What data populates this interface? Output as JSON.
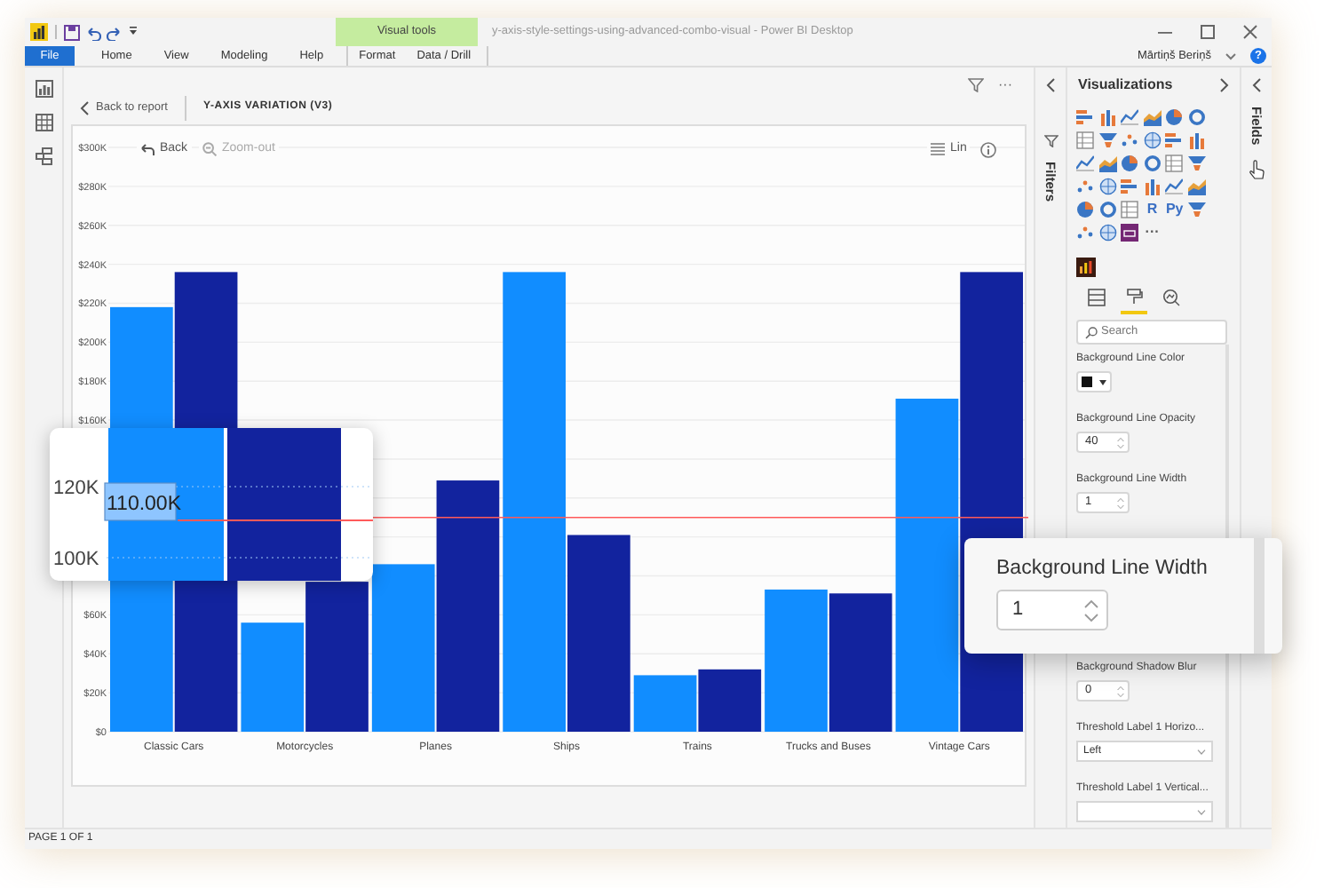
{
  "title_bar": {
    "title": "y-axis-style-settings-using-advanced-combo-visual - Power BI Desktop",
    "context_tab": "Visual tools"
  },
  "ribbon_tabs": [
    {
      "label": "File",
      "kind": "file"
    },
    {
      "label": "Home",
      "kind": "main"
    },
    {
      "label": "View",
      "kind": "main"
    },
    {
      "label": "Modeling",
      "kind": "main"
    },
    {
      "label": "Help",
      "kind": "main"
    },
    {
      "label": "Format",
      "kind": "context"
    },
    {
      "label": "Data / Drill",
      "kind": "context"
    }
  ],
  "user": {
    "name": "Mārtiņš Beriņš",
    "help": "?"
  },
  "visual_header": {
    "back_link": "Back to report",
    "title": "Y-AXIS VARIATION (V3)",
    "more": "···"
  },
  "toolbar": {
    "back": "Back",
    "zoom_out": {
      "label": "Zoom-out",
      "disabled": true
    },
    "scale": "Lin"
  },
  "chart": {
    "chart_data": {
      "type": "bar",
      "categories": [
        "Classic Cars",
        "Motorcycles",
        "Planes",
        "Ships",
        "Trains",
        "Trucks and Buses",
        "Vintage Cars"
      ],
      "series": [
        {
          "color": "#118dff",
          "values": [
            218000,
            56000,
            86000,
            236000,
            29000,
            73000,
            171000
          ]
        },
        {
          "color": "#12239e",
          "values": [
            236000,
            77000,
            129000,
            101000,
            32000,
            71000,
            236000
          ]
        }
      ],
      "grid": true,
      "ylim": [
        0,
        300000
      ],
      "yticks": [
        {
          "value": 0,
          "label": "$0"
        },
        {
          "value": 20000,
          "label": "$20K"
        },
        {
          "value": 40000,
          "label": "$40K"
        },
        {
          "value": 60000,
          "label": "$60K"
        },
        {
          "value": 160000,
          "label": "$160K"
        },
        {
          "value": 180000,
          "label": "$180K"
        },
        {
          "value": 200000,
          "label": "$200K"
        },
        {
          "value": 220000,
          "label": "$220K"
        },
        {
          "value": 240000,
          "label": "$240K"
        },
        {
          "value": 260000,
          "label": "$260K"
        },
        {
          "value": 280000,
          "label": "$280K"
        },
        {
          "value": 300000,
          "label": "$300K"
        }
      ],
      "ref_lines": [
        {
          "axis": "y",
          "value": 110000,
          "color": "#ff5a5a"
        }
      ]
    }
  },
  "zoom_popup": {
    "ticks": [
      "120K",
      "100K"
    ],
    "value": "110.00K"
  },
  "filters_pane": {
    "label": "Filters"
  },
  "visualizations": {
    "title": "Visualizations",
    "glyphs": [
      "R",
      "Py"
    ],
    "more": "···"
  },
  "format_tabs": [
    {
      "selected": false
    },
    {
      "selected": true
    },
    {
      "selected": false
    }
  ],
  "search": {
    "placeholder": "Search"
  },
  "settings": [
    {
      "kind": "color",
      "label": "Background Line Color",
      "color": "#111111"
    },
    {
      "kind": "spinner",
      "label": "Background Line Opacity",
      "value": "40"
    },
    {
      "kind": "spinner",
      "label": "Background Line Width",
      "value": "1"
    },
    {
      "kind": "spinner",
      "label": "Background Shadow Blur",
      "value": "0"
    },
    {
      "kind": "dropdown",
      "label": "Threshold Label 1 Horizo...",
      "value": "Left"
    },
    {
      "kind": "dropdown",
      "label": "Threshold Label 1 Vertical..."
    }
  ],
  "popup_field": {
    "label": "Background Line Width",
    "value": "1"
  },
  "fields_pane": {
    "label": "Fields"
  },
  "status_bar": "PAGE 1 OF 1"
}
